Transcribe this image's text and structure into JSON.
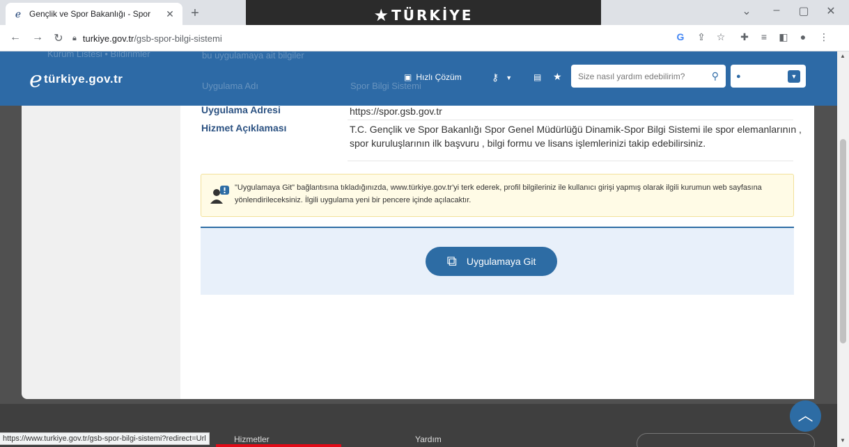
{
  "browser": {
    "tab_title": "Gençlik ve Spor Bakanlığı - Spor",
    "url_host": "turkiye.gov.tr",
    "url_path": "/gsb-spor-bilgi-sistemi",
    "banner_text": "TÜRKİYE",
    "status_url": "https://www.turkiye.gov.tr/gsb-spor-bilgi-sistemi?redirect=Url"
  },
  "header": {
    "logo_text": "türkiye.gov.tr",
    "hizli_cozum": "Hızlı Çözüm",
    "search_placeholder": "Size nasıl yardım edebilirim?",
    "ghost_left": "Kurum Listesi • Bildirimler",
    "ghost_row": "bu uygulamaya ait bilgiler",
    "ghost_uyg_adi": "Uygulama Adı",
    "ghost_uyg_adi_val": "Spor Bilgi Sistemi"
  },
  "details": {
    "rows": [
      {
        "label": "Uygulama Adresi",
        "value": "https://spor.gsb.gov.tr"
      },
      {
        "label": "Hizmet Açıklaması",
        "value": "T.C. Gençlik ve Spor Bakanlığı Spor Genel Müdürlüğü Dinamik-Spor Bilgi Sistemi ile spor elemanlarının , spor kuruluşlarının ilk başvuru , bilgi formu ve lisans işlemlerinizi takip edebilirsiniz."
      }
    ]
  },
  "alert": {
    "text": "\"Uygulamaya Git\" bağlantısına tıkladığınızda, www.türkiye.gov.tr'yi terk ederek, profil bilgileriniz ile kullanıcı girişi yapmış olarak ilgili kurumun web sayfasına yönlendirileceksiniz. İlgili uygulama yeni bir pencere içinde açılacaktır."
  },
  "action": {
    "button_label": "Uygulamaya Git"
  },
  "footer": {
    "col1": "Hizmetler",
    "col2": "Yardım"
  },
  "colors": {
    "brand_blue": "#2d6aa6",
    "alert_bg": "#fffbe6",
    "action_bg": "#e8f0fa"
  }
}
